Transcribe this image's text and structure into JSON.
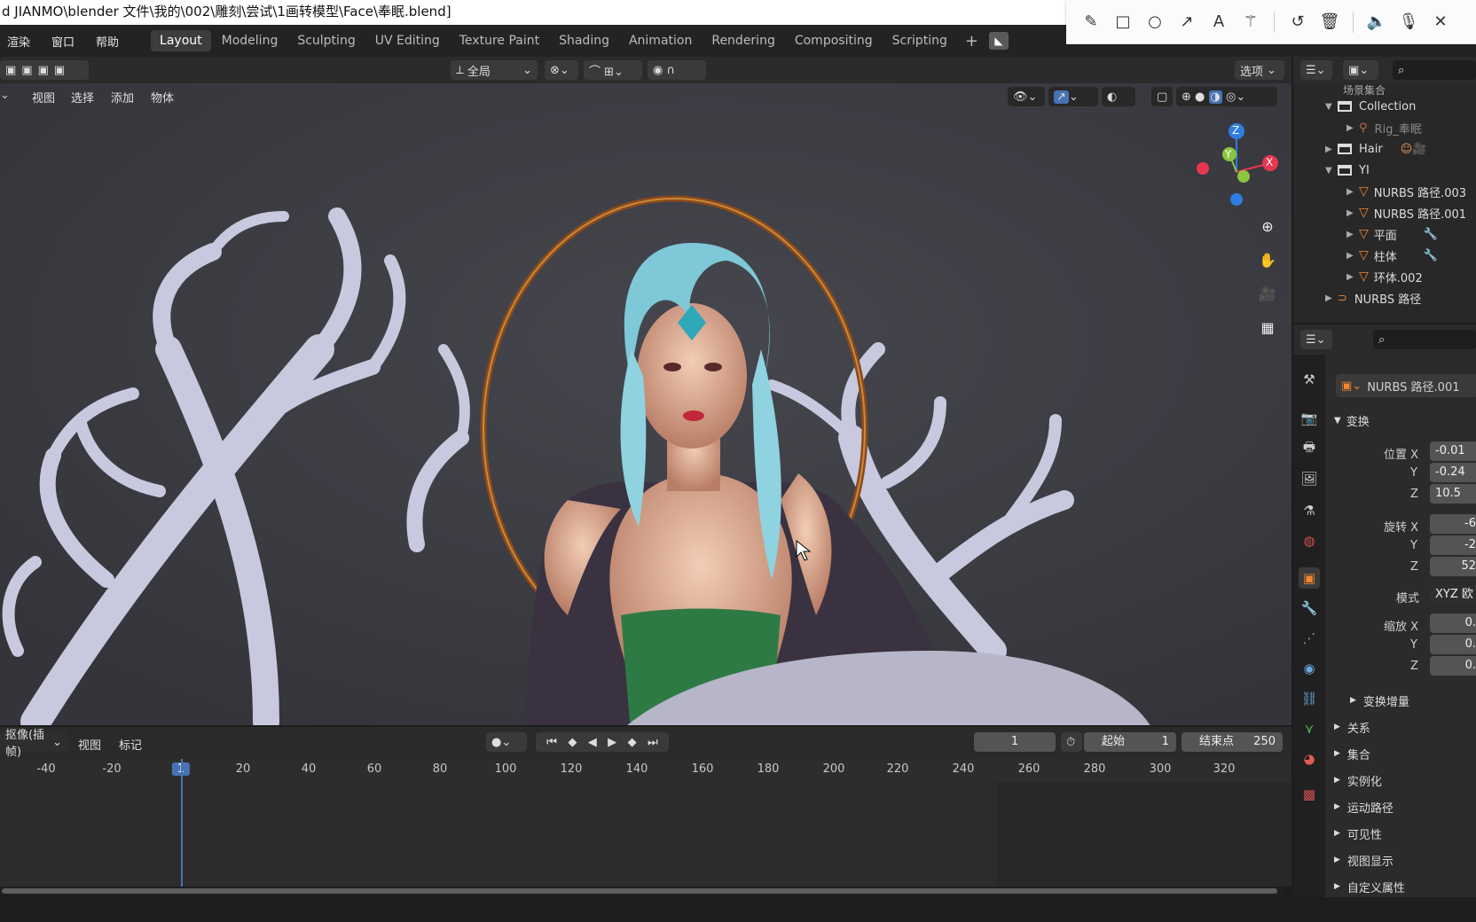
{
  "window": {
    "title": "d JIANMO\\blender 文件\\我的\\002\\雕刻\\尝试\\1画转模型\\Face\\奉眠.blend]"
  },
  "annotation_toolbar": {
    "tools": [
      "pencil-icon",
      "rectangle-icon",
      "circle-icon",
      "arrow-icon",
      "text-icon",
      "magic-wand-icon",
      "undo-icon",
      "trash-icon",
      "speaker-icon",
      "microphone-icon",
      "close-icon"
    ]
  },
  "menubar": {
    "items": [
      "渲染",
      "窗口",
      "帮助"
    ],
    "workspaces": [
      "Layout",
      "Modeling",
      "Sculpting",
      "UV Editing",
      "Texture Paint",
      "Shading",
      "Animation",
      "Rendering",
      "Compositing",
      "Scripting"
    ],
    "active_workspace": "Layout",
    "add_label": "+"
  },
  "viewport_header": {
    "transform_orientation": "全局",
    "options_label": "选项",
    "menus": [
      "视图",
      "选择",
      "添加",
      "物体"
    ]
  },
  "gizmo": {
    "z": "Z",
    "y": "Y",
    "x": "X"
  },
  "timeline": {
    "mode": "抠像(插帧)",
    "menus": [
      "视图",
      "标记"
    ],
    "current_frame": "1",
    "start_label": "起始",
    "start_value": "1",
    "end_label": "结束点",
    "end_value": "250",
    "ticks": [
      "-40",
      "-20",
      "1",
      "20",
      "40",
      "60",
      "80",
      "100",
      "120",
      "140",
      "160",
      "180",
      "200",
      "220",
      "240",
      "260",
      "280",
      "300",
      "320"
    ]
  },
  "outliner": {
    "scene_collection": "场景集合",
    "rows": [
      {
        "label": "Collection",
        "type": "collection",
        "expanded": true
      },
      {
        "label": "Rig_奉眠",
        "type": "armature",
        "dim": true
      },
      {
        "label": "Hair",
        "type": "collection",
        "expanded": false
      },
      {
        "label": "YI",
        "type": "collection",
        "expanded": true
      },
      {
        "label": "NURBS 路径.003",
        "type": "mesh"
      },
      {
        "label": "NURBS 路径.001",
        "type": "mesh"
      },
      {
        "label": "平面",
        "type": "mesh"
      },
      {
        "label": "柱体",
        "type": "mesh"
      },
      {
        "label": "环体.002",
        "type": "mesh"
      },
      {
        "label": "NURBS 路径",
        "type": "curve"
      }
    ]
  },
  "properties": {
    "object_name": "NURBS 路径.001",
    "transform_label": "变换",
    "location_label": "位置 X",
    "rotation_label": "旋转 X",
    "scale_label": "缩放 X",
    "mode_label": "模式",
    "y_label": "Y",
    "z_label": "Z",
    "location": [
      "-0.01",
      "-0.24",
      "10.5"
    ],
    "rotation": [
      "-6",
      "-2",
      "52"
    ],
    "mode_value": "XYZ 欧",
    "scale": [
      "0.",
      "0.",
      "0."
    ],
    "delta_transform": "变换增量",
    "sections": [
      "关系",
      "集合",
      "实例化",
      "运动路径",
      "可见性",
      "视图显示",
      "自定义属性"
    ]
  },
  "colors": {
    "accent_blue": "#4772b3",
    "hair": "#7ec8d8",
    "gizmo_x": "#e8364f",
    "gizmo_y": "#8bc53f",
    "gizmo_z": "#2f7de1"
  }
}
